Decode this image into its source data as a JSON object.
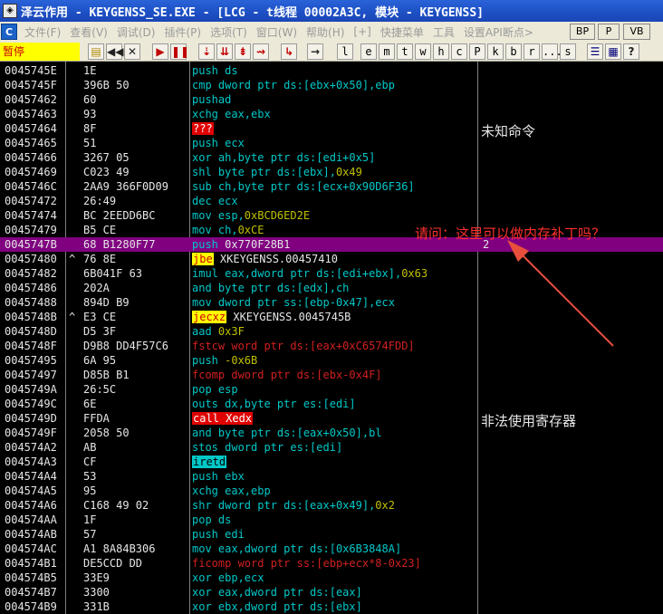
{
  "titlebar": {
    "title": "泽云作用 - KEYGENSS_SE.EXE - [LCG - t线程  00002A3C, 模块 - KEYGENSS]"
  },
  "menubar": {
    "items": [
      "文件(F)",
      "查看(V)",
      "调试(D)",
      "插件(P)",
      "选项(T)",
      "窗口(W)",
      "帮助(H)",
      "[+]",
      "快捷菜单",
      "工具",
      "设置API断点>"
    ],
    "buttons": [
      "BP",
      "P",
      "VB"
    ]
  },
  "toolbar": {
    "status": "暂停",
    "letters": [
      "l",
      "e",
      "m",
      "t",
      "w",
      "h",
      "c",
      "P",
      "k",
      "b",
      "r",
      "...",
      "s"
    ]
  },
  "rows": [
    {
      "addr": "0045745E",
      "j": "",
      "hex": "1E",
      "asm": [
        [
          "k",
          "push ds"
        ]
      ],
      "cmt": ""
    },
    {
      "addr": "0045745F",
      "j": "",
      "hex": "396B 50",
      "asm": [
        [
          "k",
          "cmp dword ptr ds:[ebx+0x50],ebp"
        ]
      ],
      "cmt": ""
    },
    {
      "addr": "00457462",
      "j": "",
      "hex": "60",
      "asm": [
        [
          "k",
          "pushad"
        ]
      ],
      "cmt": ""
    },
    {
      "addr": "00457463",
      "j": "",
      "hex": "93",
      "asm": [
        [
          "k",
          "xchg eax,ebx"
        ]
      ],
      "cmt": ""
    },
    {
      "addr": "00457464",
      "j": "",
      "hex": "8F",
      "asm": [
        [
          "hr",
          "???"
        ]
      ],
      "cmt": ""
    },
    {
      "addr": "00457465",
      "j": "",
      "hex": "51",
      "asm": [
        [
          "k",
          "push ecx"
        ]
      ],
      "cmt": ""
    },
    {
      "addr": "00457466",
      "j": "",
      "hex": "3267 05",
      "asm": [
        [
          "k",
          "xor ah,byte ptr ds:[edi+0x5]"
        ]
      ],
      "cmt": ""
    },
    {
      "addr": "00457469",
      "j": "",
      "hex": "C023 49",
      "asm": [
        [
          "k",
          "shl byte ptr ds:[ebx],"
        ],
        [
          "o",
          "0x49"
        ]
      ],
      "cmt": ""
    },
    {
      "addr": "0045746C",
      "j": "",
      "hex": "2AA9 366F0D09",
      "asm": [
        [
          "k",
          "sub ch,byte ptr ds:[ecx+0x90D6F36]"
        ]
      ],
      "cmt": ""
    },
    {
      "addr": "00457472",
      "j": "",
      "hex": "26:49",
      "asm": [
        [
          "k",
          "dec ecx"
        ]
      ],
      "cmt": ""
    },
    {
      "addr": "00457474",
      "j": "",
      "hex": "BC 2EEDD6BC",
      "asm": [
        [
          "k",
          "mov esp,"
        ],
        [
          "o",
          "0xBCD6ED2E"
        ]
      ],
      "cmt": ""
    },
    {
      "addr": "00457479",
      "j": "",
      "hex": "B5 CE",
      "asm": [
        [
          "k",
          "mov ch,"
        ],
        [
          "o",
          "0xCE"
        ]
      ],
      "cmt": ""
    },
    {
      "addr": "0045747B",
      "j": "",
      "hex": "68 B1280F77",
      "asm": [
        [
          "k",
          "push"
        ],
        [
          "t",
          " 0x770F28B1"
        ]
      ],
      "cmt": "2",
      "sel": true
    },
    {
      "addr": "00457480",
      "j": "^",
      "hex": "76 8E",
      "asm": [
        [
          "hy",
          "jbe"
        ],
        [
          "t",
          " XKEYGENSS.00457410"
        ]
      ],
      "cmt": ""
    },
    {
      "addr": "00457482",
      "j": "",
      "hex": "6B041F 63",
      "asm": [
        [
          "k",
          "imul eax,dword ptr ds:[edi+ebx],"
        ],
        [
          "o",
          "0x63"
        ]
      ],
      "cmt": ""
    },
    {
      "addr": "00457486",
      "j": "",
      "hex": "202A",
      "asm": [
        [
          "k",
          "and byte ptr ds:[edx],ch"
        ]
      ],
      "cmt": ""
    },
    {
      "addr": "00457488",
      "j": "",
      "hex": "894D B9",
      "asm": [
        [
          "k",
          "mov dword ptr ss:[ebp-0x47],ecx"
        ]
      ],
      "cmt": ""
    },
    {
      "addr": "0045748B",
      "j": "^",
      "hex": "E3 CE",
      "asm": [
        [
          "hy",
          "jecxz"
        ],
        [
          "t",
          " XKEYGENSS.0045745B"
        ]
      ],
      "cmt": ""
    },
    {
      "addr": "0045748D",
      "j": "",
      "hex": "D5 3F",
      "asm": [
        [
          "k",
          "aad "
        ],
        [
          "o",
          "0x3F"
        ]
      ],
      "cmt": ""
    },
    {
      "addr": "0045748F",
      "j": "",
      "hex": "D9B8 DD4F57C6",
      "asm": [
        [
          "r",
          "fstcw word ptr ds:[eax+0xC6574FDD]"
        ]
      ],
      "cmt": ""
    },
    {
      "addr": "00457495",
      "j": "",
      "hex": "6A 95",
      "asm": [
        [
          "k",
          "push "
        ],
        [
          "o",
          "-0x6B"
        ]
      ],
      "cmt": ""
    },
    {
      "addr": "00457497",
      "j": "",
      "hex": "D85B B1",
      "asm": [
        [
          "r",
          "fcomp dword ptr ds:[ebx-0x4F]"
        ]
      ],
      "cmt": ""
    },
    {
      "addr": "0045749A",
      "j": "",
      "hex": "26:5C",
      "asm": [
        [
          "k",
          "pop esp"
        ]
      ],
      "cmt": ""
    },
    {
      "addr": "0045749C",
      "j": "",
      "hex": "6E",
      "asm": [
        [
          "k",
          "outs dx,byte ptr es:[edi]"
        ]
      ],
      "cmt": ""
    },
    {
      "addr": "0045749D",
      "j": "",
      "hex": "FFDA",
      "asm": [
        [
          "hr",
          "call Xedx"
        ]
      ],
      "cmt": ""
    },
    {
      "addr": "0045749F",
      "j": "",
      "hex": "2058 50",
      "asm": [
        [
          "k",
          "and byte ptr ds:[eax+0x50],bl"
        ]
      ],
      "cmt": ""
    },
    {
      "addr": "004574A2",
      "j": "",
      "hex": "AB",
      "asm": [
        [
          "k",
          "stos dword ptr es:[edi]"
        ]
      ],
      "cmt": ""
    },
    {
      "addr": "004574A3",
      "j": "",
      "hex": "CF",
      "asm": [
        [
          "hc",
          "iretd"
        ]
      ],
      "cmt": ""
    },
    {
      "addr": "004574A4",
      "j": "",
      "hex": "53",
      "asm": [
        [
          "k",
          "push ebx"
        ]
      ],
      "cmt": ""
    },
    {
      "addr": "004574A5",
      "j": "",
      "hex": "95",
      "asm": [
        [
          "k",
          "xchg eax,ebp"
        ]
      ],
      "cmt": ""
    },
    {
      "addr": "004574A6",
      "j": "",
      "hex": "C168 49 02",
      "asm": [
        [
          "k",
          "shr dword ptr ds:[eax+0x49],"
        ],
        [
          "o",
          "0x2"
        ]
      ],
      "cmt": ""
    },
    {
      "addr": "004574AA",
      "j": "",
      "hex": "1F",
      "asm": [
        [
          "k",
          "pop ds"
        ]
      ],
      "cmt": ""
    },
    {
      "addr": "004574AB",
      "j": "",
      "hex": "57",
      "asm": [
        [
          "k",
          "push edi"
        ]
      ],
      "cmt": ""
    },
    {
      "addr": "004574AC",
      "j": "",
      "hex": "A1 8A84B306",
      "asm": [
        [
          "k",
          "mov eax,dword ptr ds:[0x6B3848A]"
        ]
      ],
      "cmt": ""
    },
    {
      "addr": "004574B1",
      "j": "",
      "hex": "DE5CCD DD",
      "asm": [
        [
          "r",
          "ficomp word ptr ss:[ebp+ecx*8-0x23]"
        ]
      ],
      "cmt": ""
    },
    {
      "addr": "004574B5",
      "j": "",
      "hex": "33E9",
      "asm": [
        [
          "k",
          "xor ebp,ecx"
        ]
      ],
      "cmt": ""
    },
    {
      "addr": "004574B7",
      "j": "",
      "hex": "3300",
      "asm": [
        [
          "k",
          "xor eax,dword ptr ds:[eax]"
        ]
      ],
      "cmt": ""
    },
    {
      "addr": "004574B9",
      "j": "",
      "hex": "331B",
      "asm": [
        [
          "k",
          "xor ebx,dword ptr ds:[ebx]"
        ]
      ],
      "cmt": ""
    }
  ],
  "notes": {
    "unknown_cmd": "未知命令",
    "illegal_reg": "非法使用寄存器",
    "question": "请问：这里可以做内存补丁吗？"
  },
  "colors": {
    "selection": "#800080",
    "keyword": "#00c8c8",
    "arrow": "#e8503c"
  }
}
